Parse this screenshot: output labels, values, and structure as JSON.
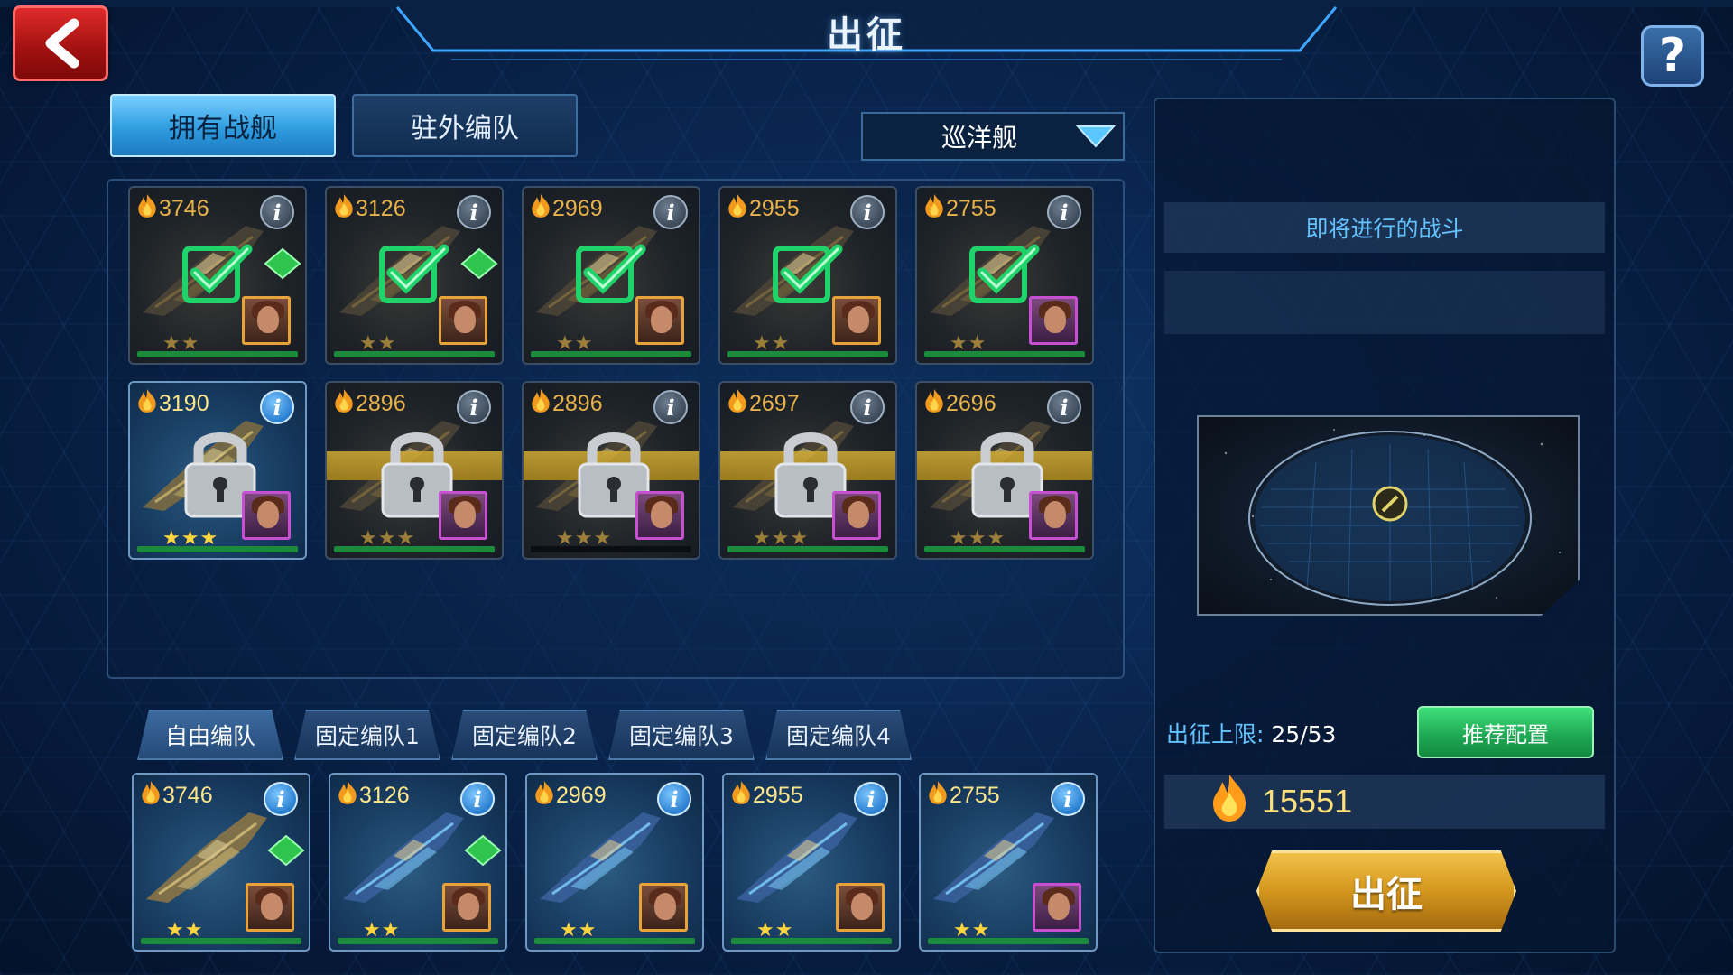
{
  "header": {
    "title": "出征"
  },
  "tabs": {
    "owned": "拥有战舰",
    "garrison": "驻外编队"
  },
  "filter": {
    "selected": "巡洋舰"
  },
  "ships": [
    {
      "power": "3746",
      "stars": "★★",
      "selected": true,
      "locked": false
    },
    {
      "power": "3126",
      "stars": "★★",
      "selected": true,
      "locked": false
    },
    {
      "power": "2969",
      "stars": "★★",
      "selected": true,
      "locked": false
    },
    {
      "power": "2955",
      "stars": "★★",
      "selected": true,
      "locked": false
    },
    {
      "power": "2755",
      "stars": "★★",
      "selected": true,
      "locked": false
    },
    {
      "power": "3190",
      "stars": "★★★",
      "selected": false,
      "locked": true
    },
    {
      "power": "2896",
      "stars": "★★★",
      "selected": false,
      "locked": true
    },
    {
      "power": "2896",
      "stars": "★★★",
      "selected": false,
      "locked": true
    },
    {
      "power": "2697",
      "stars": "★★★",
      "selected": false,
      "locked": true
    },
    {
      "power": "2696",
      "stars": "★★★",
      "selected": false,
      "locked": true
    }
  ],
  "formation_tabs": [
    "自由编队",
    "固定编队1",
    "固定编队2",
    "固定编队3",
    "固定编队4"
  ],
  "formation": [
    {
      "power": "3746",
      "stars": "★★"
    },
    {
      "power": "3126",
      "stars": "★★"
    },
    {
      "power": "2969",
      "stars": "★★"
    },
    {
      "power": "2955",
      "stars": "★★"
    },
    {
      "power": "2755",
      "stars": "★★"
    }
  ],
  "right_panel": {
    "upcoming_battle": "即将进行的战斗",
    "limit_label": "出征上限:",
    "limit_value": "25/53",
    "recommend": "推荐配置",
    "total_power": "15551",
    "deploy": "出征"
  },
  "colors": {
    "accent_blue": "#2e9de0",
    "deploy_gold": "#d79b1f",
    "recommend_green": "#1ea653",
    "back_red": "#c41c1c"
  },
  "icons": {
    "back": "chevron-left-icon",
    "help": "question-mark-icon",
    "info": "info-icon",
    "power": "flame-icon",
    "lock": "padlock-icon",
    "check": "checkmark-icon"
  }
}
